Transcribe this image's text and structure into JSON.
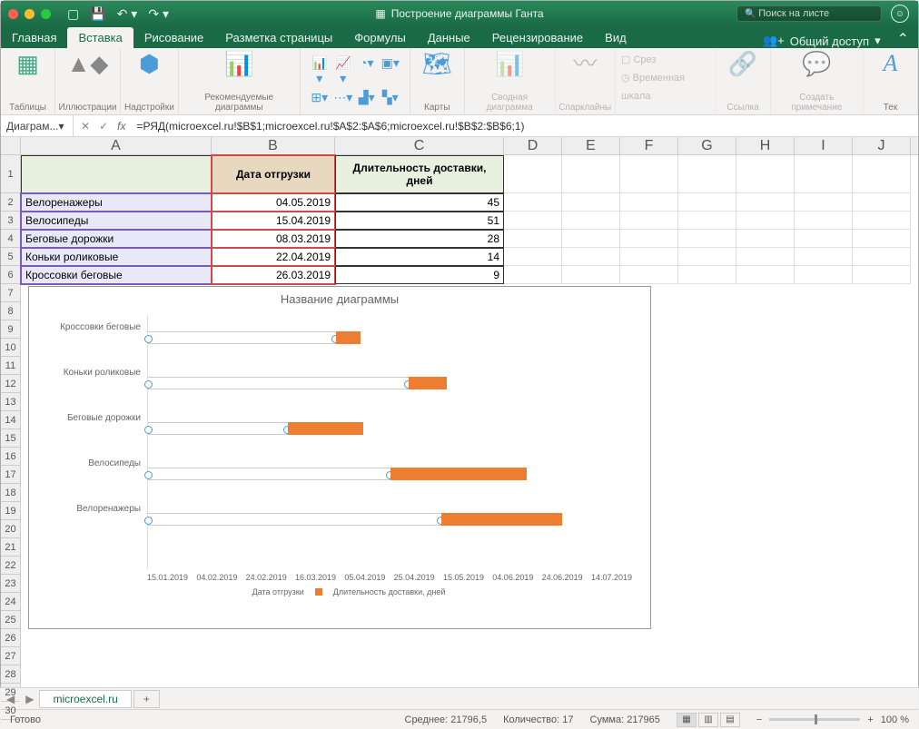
{
  "titlebar": {
    "doc_title": "Построение диаграммы Ганта",
    "search_placeholder": "Поиск на листе"
  },
  "tabs": {
    "home": "Главная",
    "insert": "Вставка",
    "draw": "Рисование",
    "layout": "Разметка страницы",
    "formulas": "Формулы",
    "data": "Данные",
    "review": "Рецензирование",
    "view": "Вид",
    "share": "Общий доступ"
  },
  "ribbon": {
    "tables": "Таблицы",
    "illustrations": "Иллюстрации",
    "addins": "Надстройки",
    "recommended": "Рекомендуемые диаграммы",
    "maps": "Карты",
    "pivotchart": "Сводная диаграмма",
    "sparklines": "Спарклайны",
    "slicer": "Срез",
    "timeline": "Временная шкала",
    "link": "Ссылка",
    "comment": "Создать примечание",
    "text": "Тек"
  },
  "formula_bar": {
    "name": "Диаграм...",
    "formula": "=РЯД(microexcel.ru!$B$1;microexcel.ru!$A$2:$A$6;microexcel.ru!$B$2:$B$6;1)"
  },
  "columns": [
    "A",
    "B",
    "C",
    "D",
    "E",
    "F",
    "G",
    "H",
    "I",
    "J"
  ],
  "headers": {
    "A": "",
    "B": "Дата отгрузки",
    "C": "Длительность доставки, дней"
  },
  "rows": [
    {
      "n": 2,
      "A": "Велоренажеры",
      "B": "04.05.2019",
      "C": "45"
    },
    {
      "n": 3,
      "A": "Велосипеды",
      "B": "15.04.2019",
      "C": "51"
    },
    {
      "n": 4,
      "A": "Беговые дорожки",
      "B": "08.03.2019",
      "C": "28"
    },
    {
      "n": 5,
      "A": "Коньки роликовые",
      "B": "22.04.2019",
      "C": "14"
    },
    {
      "n": 6,
      "A": "Кроссовки беговые",
      "B": "26.03.2019",
      "C": "9"
    }
  ],
  "chart": {
    "title": "Название диаграммы",
    "legend1": "Дата отгрузки",
    "legend2": "Длительность доставки, дней",
    "xticks": [
      "15.01.2019",
      "04.02.2019",
      "24.02.2019",
      "16.03.2019",
      "05.04.2019",
      "25.04.2019",
      "15.05.2019",
      "04.06.2019",
      "24.06.2019",
      "14.07.2019"
    ]
  },
  "chart_data": {
    "type": "bar",
    "orientation": "horizontal",
    "title": "Название диаграммы",
    "x_type": "date",
    "xlim": [
      "15.01.2019",
      "14.07.2019"
    ],
    "categories": [
      "Кроссовки беговые",
      "Коньки роликовые",
      "Беговые дорожки",
      "Велосипеды",
      "Велоренажеры"
    ],
    "series": [
      {
        "name": "Дата отгрузки",
        "values": [
          "26.03.2019",
          "22.04.2019",
          "08.03.2019",
          "15.04.2019",
          "04.05.2019"
        ],
        "color": "transparent"
      },
      {
        "name": "Длительность доставки, дней",
        "values": [
          9,
          14,
          28,
          51,
          45
        ],
        "color": "#ed7d31"
      }
    ],
    "xticks": [
      "15.01.2019",
      "04.02.2019",
      "24.02.2019",
      "16.03.2019",
      "05.04.2019",
      "25.04.2019",
      "15.05.2019",
      "04.06.2019",
      "24.06.2019",
      "14.07.2019"
    ]
  },
  "sheet": {
    "name": "microexcel.ru"
  },
  "status": {
    "ready": "Готово",
    "avg_lbl": "Среднее:",
    "avg": "21796,5",
    "count_lbl": "Количество:",
    "count": "17",
    "sum_lbl": "Сумма:",
    "sum": "217965",
    "zoom": "100 %"
  }
}
